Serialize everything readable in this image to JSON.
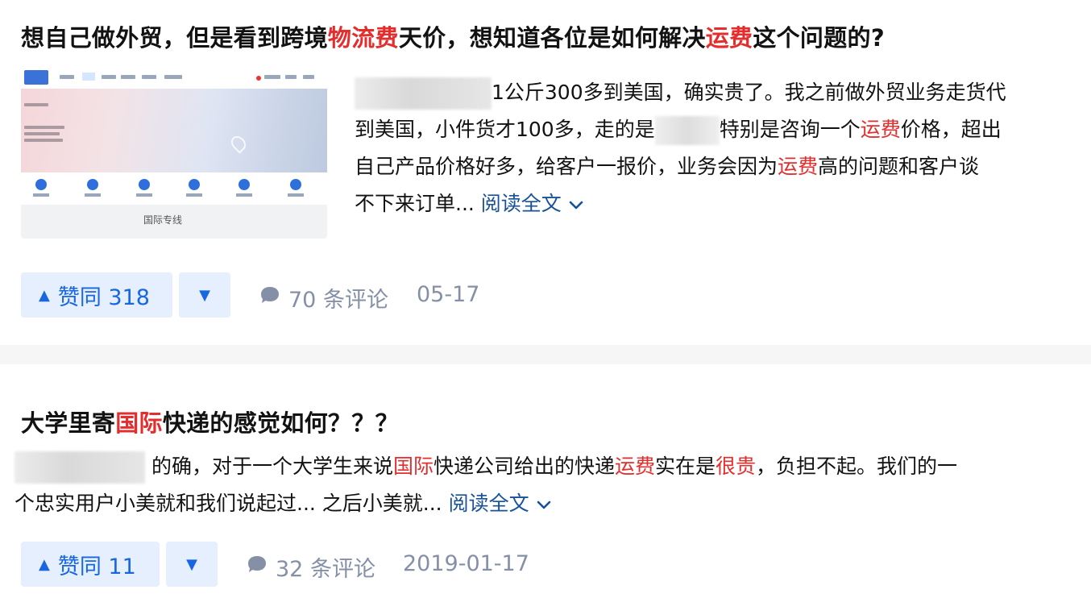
{
  "answers": [
    {
      "title_parts": [
        {
          "text": "想自己做外贸，但是看到跨境",
          "hl": false
        },
        {
          "text": "物流费",
          "hl": true
        },
        {
          "text": "天价，想知道各位是如何解决",
          "hl": false
        },
        {
          "text": "运费",
          "hl": true
        },
        {
          "text": "这个问题的?",
          "hl": false
        }
      ],
      "body_lines": [
        [
          {
            "text": "1公斤300多到美国，确实贵了。我之前做外贸业务走货代",
            "hl": false
          }
        ],
        [
          {
            "text": "到美国，小件货才100多，走的是",
            "hl": false
          },
          {
            "text": "特别是咨询一个",
            "hl": false
          },
          {
            "text": "运费",
            "hl": true
          },
          {
            "text": "价格，超出",
            "hl": false
          }
        ],
        [
          {
            "text": "自己产品价格好多，给客户一报价，业务会因为",
            "hl": false
          },
          {
            "text": "运费",
            "hl": true
          },
          {
            "text": "高的问题和客户谈",
            "hl": false
          }
        ],
        [
          {
            "text": "不下来订单... ",
            "hl": false
          }
        ]
      ],
      "read_more": "阅读全文",
      "thumbnail_caption": "国际专线",
      "upvote_label": "赞同 318",
      "comments": "70 条评论",
      "date": "05-17"
    },
    {
      "title_parts": [
        {
          "text": "大学里寄",
          "hl": false
        },
        {
          "text": "国际",
          "hl": true
        },
        {
          "text": "快递的感觉如何？？？",
          "hl": false
        }
      ],
      "body_lines": [
        [
          {
            "text": " 的确，对于一个大学生来说",
            "hl": false
          },
          {
            "text": "国际",
            "hl": true
          },
          {
            "text": "快递公司给出的快递",
            "hl": false
          },
          {
            "text": "运费",
            "hl": true
          },
          {
            "text": "实在是",
            "hl": false
          },
          {
            "text": "很贵",
            "hl": true
          },
          {
            "text": "，负担不起。我们的一",
            "hl": false
          }
        ],
        [
          {
            "text": "个忠实用户小美就和我们说起过... 之后小美就... ",
            "hl": false
          }
        ]
      ],
      "read_more": "阅读全文",
      "upvote_label": "赞同 11",
      "comments": "32 条评论",
      "date": "2019-01-17"
    }
  ],
  "colors": {
    "highlight": "#e42d2d",
    "link": "#175199",
    "vote_bg": "#e5effd",
    "vote_fg": "#1866e0",
    "meta": "#8590a6"
  },
  "icons": {
    "upvote": "triangle-up-icon",
    "downvote": "triangle-down-icon",
    "comment": "comment-bubble-icon",
    "expand": "chevron-down-icon"
  }
}
